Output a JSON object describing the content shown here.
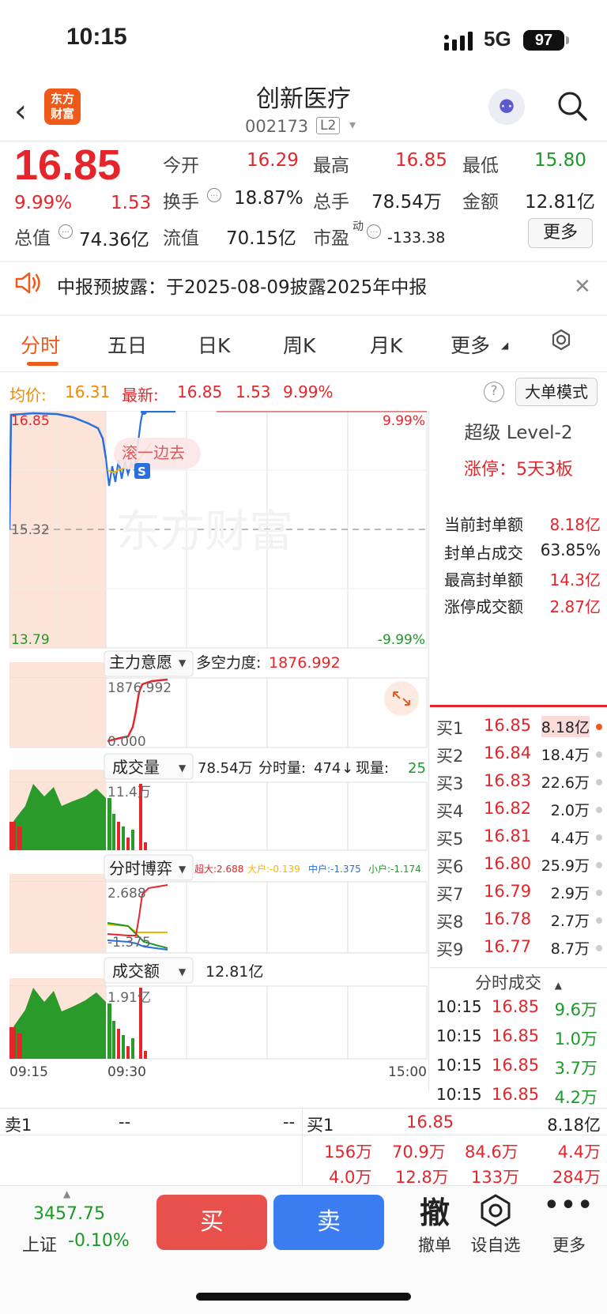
{
  "status_bar": {
    "time": "10:15",
    "network": "5G",
    "battery": "97"
  },
  "header": {
    "title": "创新医疗",
    "code": "002173",
    "level_badge": "L2",
    "logo_line1": "东方",
    "logo_line2": "财富",
    "back_icon": "chevron-left-icon",
    "search_icon": "search-icon"
  },
  "quote": {
    "price": "16.85",
    "change_pct": "9.99%",
    "change_amt": "1.53",
    "open_label": "今开",
    "open": "16.29",
    "high_label": "最高",
    "high": "16.85",
    "low_label": "最低",
    "low": "15.80",
    "turnover_label": "换手",
    "turnover": "18.87%",
    "vol_label": "总手",
    "vol": "78.54万",
    "amount_label": "金额",
    "amount": "12.81亿",
    "mcap_label": "总值",
    "mcap": "74.36亿",
    "float_label": "流值",
    "float": "70.15亿",
    "pe_label": "市盈",
    "pe_sup": "动",
    "pe": "-133.38",
    "more_label": "更多"
  },
  "notice": {
    "text": "中报预披露：于2025-08-09披露2025年中报"
  },
  "tabs": [
    {
      "label": "分时",
      "active": true
    },
    {
      "label": "五日"
    },
    {
      "label": "日K"
    },
    {
      "label": "周K"
    },
    {
      "label": "月K"
    },
    {
      "label": "更多"
    }
  ],
  "avg_line": {
    "avg_label": "均价:",
    "avg": "16.31",
    "latest_label": "最新:",
    "latest": "16.85",
    "latest_amt": "1.53",
    "latest_pct": "9.99%",
    "mode_button": "大单模式"
  },
  "chart": {
    "y_top": "16.85",
    "y_mid": "15.32",
    "y_bottom": "13.79",
    "pct_top": "9.99%",
    "pct_bottom": "-9.99%",
    "watermark": "东方财富",
    "scroll_tip": "滚一边去",
    "s_badge": "S",
    "panel1_select": "主力意愿",
    "panel1_metric_label": "多空力度:",
    "panel1_metric": "1876.992",
    "panel1_top": "1876.992",
    "panel1_bottom": "0.000",
    "panel2_select": "成交量",
    "panel2_info1": "78.54万",
    "panel2_info2_label": "分时量:",
    "panel2_info2": "474",
    "panel2_info3_label": "现量:",
    "panel2_info3": "25",
    "panel2_top": "11.4万",
    "panel3_select": "分时博弈",
    "panel3_big_label": "超大:",
    "panel3_big": "2.688",
    "panel3_large_label": "大户:",
    "panel3_large": "-0.139",
    "panel3_mid_label": "中户:",
    "panel3_mid": "-1.375",
    "panel3_small_label": "小户:",
    "panel3_small": "-1.174",
    "panel3_top": "2.688",
    "panel3_bottom": "-1.375",
    "panel4_select": "成交额",
    "panel4_info": "12.81亿",
    "panel4_top": "1.91亿",
    "x_start": "09:15",
    "x_open": "09:30",
    "x_end": "15:00"
  },
  "level2": {
    "title": "超级 Level-2",
    "limit_up": "涨停：5天3板",
    "rows": [
      {
        "label": "当前封单额",
        "value": "8.18亿",
        "color": "red"
      },
      {
        "label": "封单占成交",
        "value": "63.85%",
        "color": "black"
      },
      {
        "label": "最高封单额",
        "value": "14.3亿",
        "color": "red"
      },
      {
        "label": "涨停成交额",
        "value": "2.87亿",
        "color": "red"
      }
    ]
  },
  "order_book": [
    {
      "label": "买1",
      "price": "16.85",
      "vol": "8.18亿"
    },
    {
      "label": "买2",
      "price": "16.84",
      "vol": "18.4万"
    },
    {
      "label": "买3",
      "price": "16.83",
      "vol": "22.6万"
    },
    {
      "label": "买4",
      "price": "16.82",
      "vol": "2.0万"
    },
    {
      "label": "买5",
      "price": "16.81",
      "vol": "4.4万"
    },
    {
      "label": "买6",
      "price": "16.80",
      "vol": "25.9万"
    },
    {
      "label": "买7",
      "price": "16.79",
      "vol": "2.9万"
    },
    {
      "label": "买8",
      "price": "16.78",
      "vol": "2.7万"
    },
    {
      "label": "买9",
      "price": "16.77",
      "vol": "8.7万"
    }
  ],
  "ticks": {
    "title": "分时成交",
    "rows": [
      {
        "time": "10:15",
        "price": "16.85",
        "vol": "9.6万"
      },
      {
        "time": "10:15",
        "price": "16.85",
        "vol": "1.0万"
      },
      {
        "time": "10:15",
        "price": "16.85",
        "vol": "3.7万"
      },
      {
        "time": "10:15",
        "price": "16.85",
        "vol": "4.2万"
      }
    ]
  },
  "summary": {
    "sell_label": "卖1",
    "sell_price": "--",
    "sell_vol": "--",
    "buy_label": "买1",
    "buy_price": "16.85",
    "buy_vol": "8.18亿",
    "queue1": [
      "156万",
      "70.9万",
      "84.6万",
      "4.4万"
    ],
    "queue2": [
      "4.0万",
      "12.8万",
      "133万",
      "284万"
    ]
  },
  "bottom": {
    "index_value": "3457.75",
    "index_name": "上证",
    "index_pct": "-0.10%",
    "buy": "买",
    "sell": "卖",
    "cancel_glyph": "撤",
    "cancel": "撤单",
    "watchlist": "设自选",
    "more": "更多"
  }
}
